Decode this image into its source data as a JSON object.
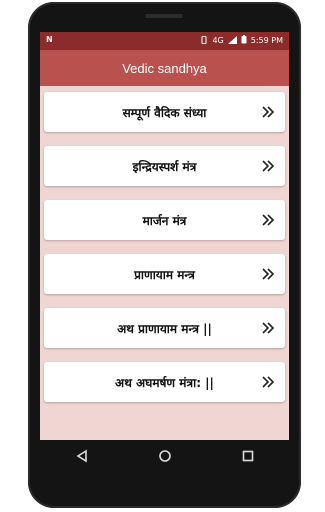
{
  "status": {
    "network_icon": "n-icon",
    "left_label": "N",
    "network_type": "4G",
    "time": "5:59 PM",
    "colors": {
      "statusbar": "#8c2b2b"
    }
  },
  "appbar": {
    "title": "Vedic sandhya",
    "color": "#b9524f"
  },
  "list": {
    "items": [
      {
        "label": "सम्पूर्ण वैदिक संध्या"
      },
      {
        "label": "इन्द्रियस्पर्श मंत्र"
      },
      {
        "label": "मार्जन मंत्र"
      },
      {
        "label": "प्राणायाम मन्त्र"
      },
      {
        "label": "अथ प्राणायाम मन्त्र ||"
      },
      {
        "label": "अथ अघमर्षण मंत्रा: ||"
      }
    ]
  },
  "navbar": {
    "back_icon": "back-icon",
    "home_icon": "home-icon",
    "recents_icon": "recents-icon"
  }
}
